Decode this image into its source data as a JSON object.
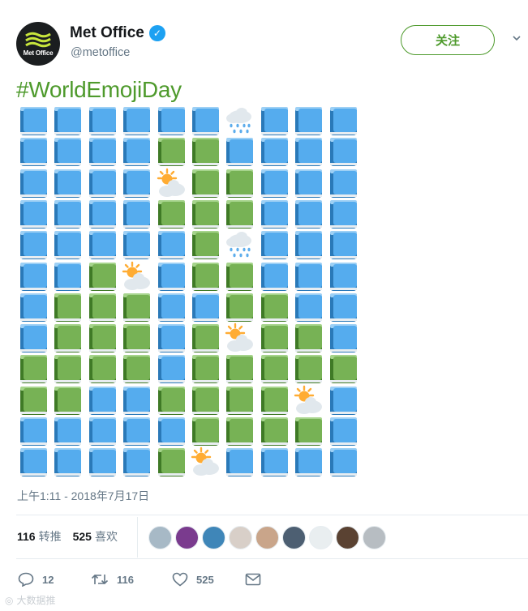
{
  "author": {
    "display_name": "Met Office",
    "handle": "@metoffice",
    "logo_text": "Met Office",
    "verified_icon": "verified-check-icon"
  },
  "follow_label": "关注",
  "caret_icon": "chevron-down-icon",
  "hashtag": "#WorldEmojiDay",
  "emoji_grid": {
    "rows": [
      "BBBBBBRBBB",
      "BBBBGGBBBB",
      "BBBBSGGBBB",
      "BBBBGGGBBB",
      "BBBBBGRBBB",
      "BBGSBGGBBB",
      "BGGGBBGGBB",
      "BGGGBGSGGB",
      "GGGGBGGGGG",
      "GGBBGGGGSB",
      "BBBBBGGGGB",
      "BBBBGSBBBB"
    ],
    "legend": {
      "B": "blue-book-emoji",
      "G": "green-book-emoji",
      "S": "sun-behind-cloud-emoji",
      "R": "rain-cloud-emoji"
    },
    "colors": {
      "blue": "#55acee",
      "green": "#77b255"
    }
  },
  "timestamp": "上午1:11 - 2018年7月17日",
  "stats": {
    "retweets_count": "116",
    "retweets_label": "转推",
    "likes_count": "525",
    "likes_label": "喜欢"
  },
  "liker_avatars": [
    "#a7b9c6",
    "#7a3b8e",
    "#3f86b8",
    "#d8cfc8",
    "#c9a58a",
    "#4d5f72",
    "#e9eef0",
    "#5a4232",
    "#b7bdc2"
  ],
  "actions": {
    "reply_count": "12",
    "retweet_count": "116",
    "like_count": "525"
  },
  "watermark": "大数据推",
  "accent_color": "#4e9a2c"
}
